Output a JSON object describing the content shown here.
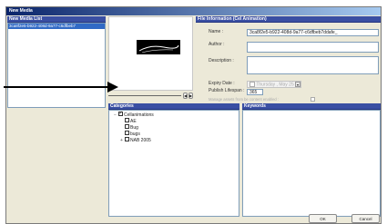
{
  "window": {
    "title": "New Media"
  },
  "media_list": {
    "header": "New Media List",
    "items": [
      "3ca8f2e5-b922-408d-9a77-c6dfbeb7"
    ]
  },
  "file_info": {
    "header": "File Information (Cel Animation)",
    "name_label": "Name :",
    "name_value": "3ca8f2e5-b922-408d-9a77-c6dfbeb7ddafe_",
    "author_label": "Author :",
    "author_value": "",
    "description_label": "Description :",
    "description_value": "",
    "expiry_label": "Expiry Date :",
    "expiry_value": "Thursday , May 25 , 2",
    "lifespan_label": "Publish Lifespan :",
    "lifespan_value": "365",
    "manage_label": "Manage assets from be content enabled :"
  },
  "categories": {
    "header": "Categories",
    "tree": [
      {
        "label": "Cellanimations",
        "checked": true,
        "expander": "−",
        "indent": 0
      },
      {
        "label": "AE",
        "checked": false,
        "expander": "",
        "indent": 1
      },
      {
        "label": "Bug",
        "checked": false,
        "expander": "",
        "indent": 1
      },
      {
        "label": "bugs",
        "checked": false,
        "expander": "",
        "indent": 1
      },
      {
        "label": "NAB 2005",
        "checked": false,
        "expander": "+",
        "indent": 1
      }
    ]
  },
  "keywords": {
    "header": "Keywords"
  },
  "preview": {
    "nav_prev": "◀",
    "nav_next": "▶"
  },
  "buttons": {
    "ok": "OK",
    "cancel": "Cancel"
  },
  "colors": {
    "accent": "#3a4fa3",
    "selection": "#316ac5",
    "preview_bg": "#000000"
  }
}
